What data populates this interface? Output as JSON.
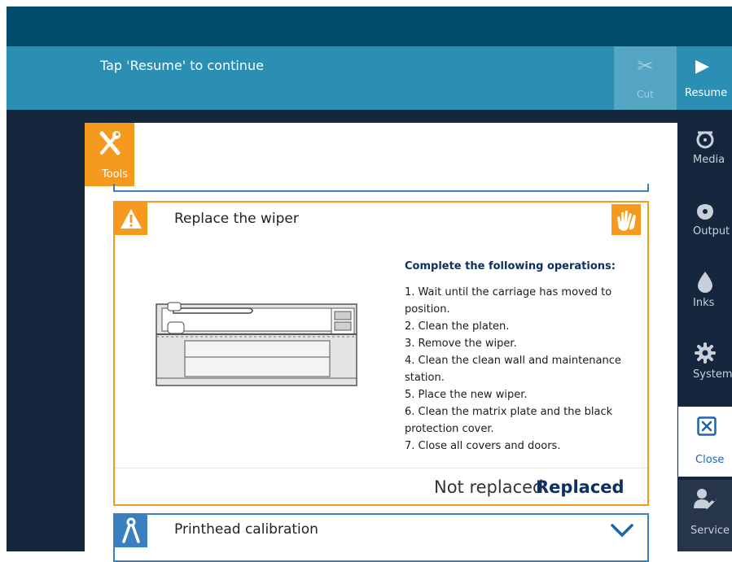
{
  "header": {
    "message": "Tap 'Resume' to continue",
    "cut_label": "Cut",
    "resume_label": "Resume"
  },
  "tools_tab": {
    "label": "Tools"
  },
  "task": {
    "title": "Replace the wiper",
    "instructions_heading": "Complete the following operations:",
    "steps": [
      "1. Wait until the carriage has moved to position.",
      "2. Clean the platen.",
      "3. Remove the wiper.",
      "4. Clean the clean wall and maintenance station.",
      "5. Place the new wiper.",
      "6. Clean the matrix plate and the black protection cover.",
      "7. Close all covers and doors."
    ],
    "not_replaced_label": "Not replaced",
    "replaced_label": "Replaced"
  },
  "next_task": {
    "title": "Printhead calibration"
  },
  "sidebar": {
    "items": [
      {
        "label": "Media",
        "icon": "media-icon"
      },
      {
        "label": "Output",
        "icon": "output-icon"
      },
      {
        "label": "Inks",
        "icon": "ink-drop-icon"
      },
      {
        "label": "System",
        "icon": "gear-icon"
      },
      {
        "label": "Close",
        "icon": "close-icon"
      },
      {
        "label": "Service",
        "icon": "service-icon"
      }
    ]
  },
  "colors": {
    "top_bar": "#004a6a",
    "message_bar": "#2a8fb2",
    "accent_orange": "#f59a1e",
    "accent_blue": "#3a7fc0",
    "dark_background": "#16263d"
  }
}
